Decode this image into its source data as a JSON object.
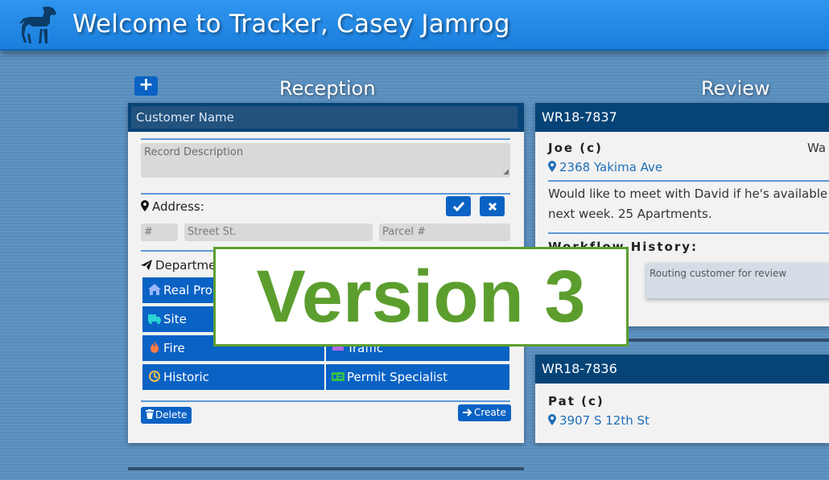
{
  "header": {
    "title": "Welcome to Tracker, Casey Jamrog"
  },
  "columns": {
    "reception": "Reception",
    "review": "Review"
  },
  "reception": {
    "add_label": "+",
    "customer_name_placeholder": "Customer Name",
    "description_placeholder": "Record Description",
    "address_label": "Address:",
    "fields": {
      "number": "#",
      "street": "Street St.",
      "parcel": "Parcel #"
    },
    "departments_label": "Departments:",
    "departments": [
      {
        "label": "Real Property",
        "icon": "home-icon"
      },
      {
        "label": "Site",
        "icon": "truck-icon"
      },
      {
        "label": "Fire",
        "icon": "flame-icon"
      },
      {
        "label": "Traffic",
        "icon": "car-icon"
      },
      {
        "label": "Historic",
        "icon": "history-icon"
      },
      {
        "label": "Permit Specialist",
        "icon": "id-card-icon"
      }
    ],
    "delete_label": "Delete",
    "create_label": "Create"
  },
  "review_records": [
    {
      "id": "WR18-7837",
      "customer": "Joe (c)",
      "status_partial": "Wa",
      "address": "2368 Yakima Ave",
      "description": "Would like to meet with David if he's available next week. 25 Apartments.",
      "workflow_label": "Workflow History:",
      "history_note": "Routing customer for review"
    },
    {
      "id": "WR18-7836",
      "customer": "Pat (c)",
      "address": "3907 S 12th St"
    }
  ],
  "overlay": {
    "text": "Version 3"
  },
  "colors": {
    "primary": "#0a62c4",
    "header": "#1a7fdd",
    "dark_bar": "#064477",
    "version_green": "#5c9e2e"
  }
}
